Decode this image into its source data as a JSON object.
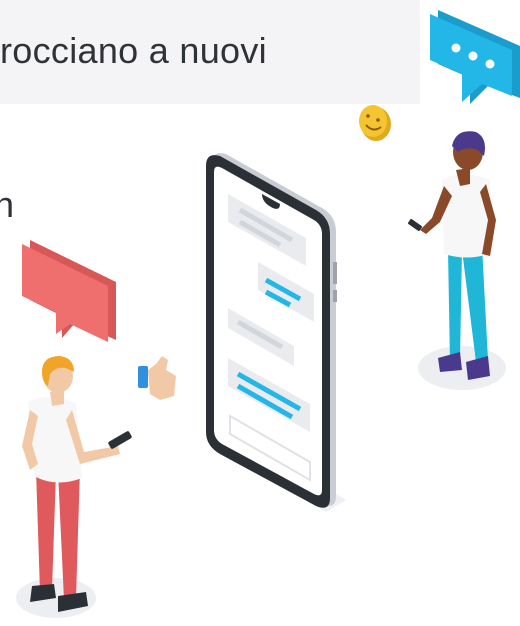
{
  "hero": {
    "headline_line1": "rocciano a nuovi",
    "headline_line2": "n"
  },
  "colors": {
    "banner_bg": "#f4f4f6",
    "text": "#2f3237",
    "accent_blue": "#22b7e6",
    "accent_red": "#ef6f6f",
    "phone_frame": "#2b2f36",
    "emoji_yellow": "#f4c431"
  },
  "icons": [
    "chat-bubble-dots-icon",
    "chat-bubble-red-icon",
    "smiley-emoji-icon",
    "thumbs-up-icon",
    "smartphone-chat-icon"
  ]
}
